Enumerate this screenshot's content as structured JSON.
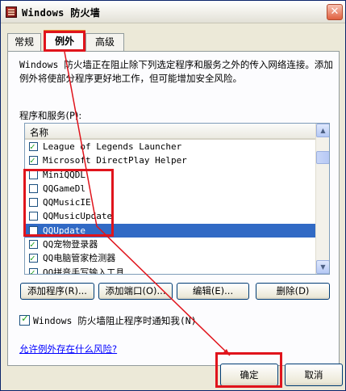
{
  "window": {
    "title": "Windows 防火墙",
    "close_glyph": "✕"
  },
  "tabs": [
    {
      "label": "常规"
    },
    {
      "label": "例外"
    },
    {
      "label": "高级"
    }
  ],
  "main": {
    "description": "Windows 防火墙正在阻止除下列选定程序和服务之外的传入网络连接。添加例外将使部分程序更好地工作，但可能增加安全风险。",
    "programs_label": "程序和服务(P):",
    "list_header": "名称",
    "rows": [
      {
        "name": "League of Legends Launcher",
        "checked": true
      },
      {
        "name": "Microsoft DirectPlay Helper",
        "checked": true
      },
      {
        "name": "MiniQQDL",
        "checked": false
      },
      {
        "name": "QQGameDl",
        "checked": false
      },
      {
        "name": "QQMusicIE",
        "checked": false
      },
      {
        "name": "QQMusicUpdate",
        "checked": false
      },
      {
        "name": "QQUpdate",
        "checked": false,
        "selected": true
      },
      {
        "name": "QQ宠物登录器",
        "checked": true
      },
      {
        "name": "QQ电脑管家检测器",
        "checked": true
      },
      {
        "name": "QQ拼音手写输入工具",
        "checked": true
      }
    ],
    "scroll_up_glyph": "▲",
    "scroll_down_glyph": "▼"
  },
  "buttons": {
    "add_program": "添加程序(R)...",
    "add_port": "添加端口(O)...",
    "edit": "编辑(E)...",
    "delete": "删除(D)",
    "ok": "确定",
    "cancel": "取消"
  },
  "notify": {
    "label": "Windows 防火墙阻止程序时通知我(N)",
    "checked": true
  },
  "risk_link": "允许例外存在什么风险?",
  "colors": {
    "selection": "#316ac5",
    "annotation_red": "#e0141c",
    "dialog_face": "#ece9d8"
  }
}
